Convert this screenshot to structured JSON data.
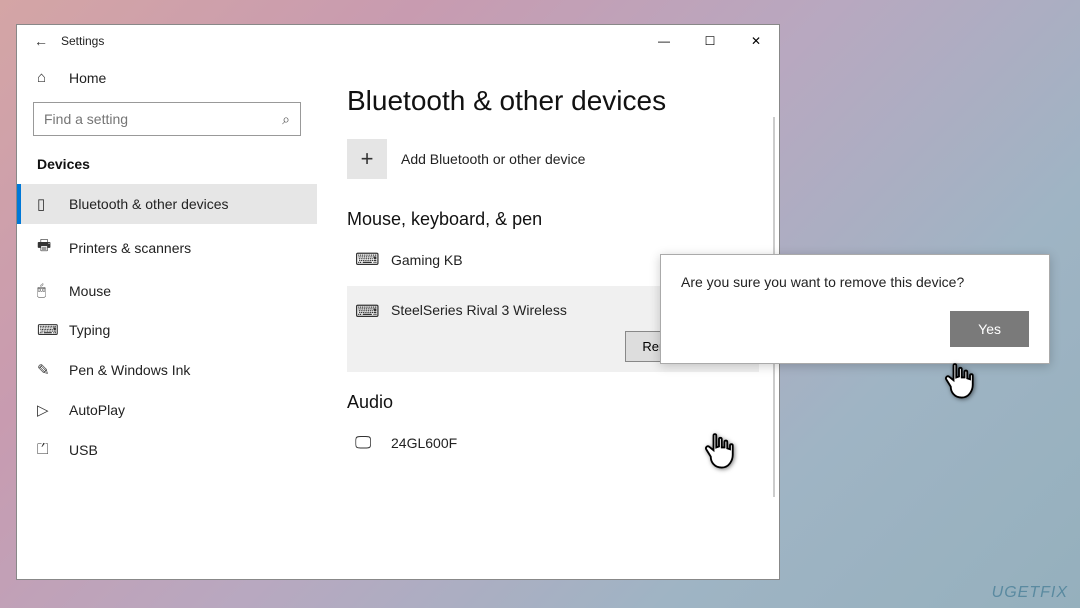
{
  "window": {
    "title": "Settings",
    "controls": {
      "minimize": "—",
      "maximize": "☐",
      "close": "✕"
    }
  },
  "sidebar": {
    "home": "Home",
    "search_placeholder": "Find a setting",
    "section": "Devices",
    "items": [
      {
        "icon": "bluetooth",
        "label": "Bluetooth & other devices",
        "selected": true
      },
      {
        "icon": "printer",
        "label": "Printers & scanners"
      },
      {
        "icon": "mouse",
        "label": "Mouse"
      },
      {
        "icon": "typing",
        "label": "Typing"
      },
      {
        "icon": "pen",
        "label": "Pen & Windows Ink"
      },
      {
        "icon": "autoplay",
        "label": "AutoPlay"
      },
      {
        "icon": "usb",
        "label": "USB"
      }
    ]
  },
  "content": {
    "title": "Bluetooth & other devices",
    "add_label": "Add Bluetooth or other device",
    "groups": [
      {
        "title": "Mouse, keyboard, & pen",
        "devices": [
          {
            "name": "Gaming KB",
            "icon": "keyboard"
          },
          {
            "name": "SteelSeries Rival 3 Wireless",
            "icon": "keyboard",
            "expanded": true
          }
        ]
      },
      {
        "title": "Audio",
        "devices": [
          {
            "name": "24GL600F",
            "icon": "monitor"
          }
        ]
      }
    ],
    "remove_button": "Remove device"
  },
  "dialog": {
    "message": "Are you sure you want to remove this device?",
    "yes": "Yes"
  },
  "watermark": "UGETFIX"
}
